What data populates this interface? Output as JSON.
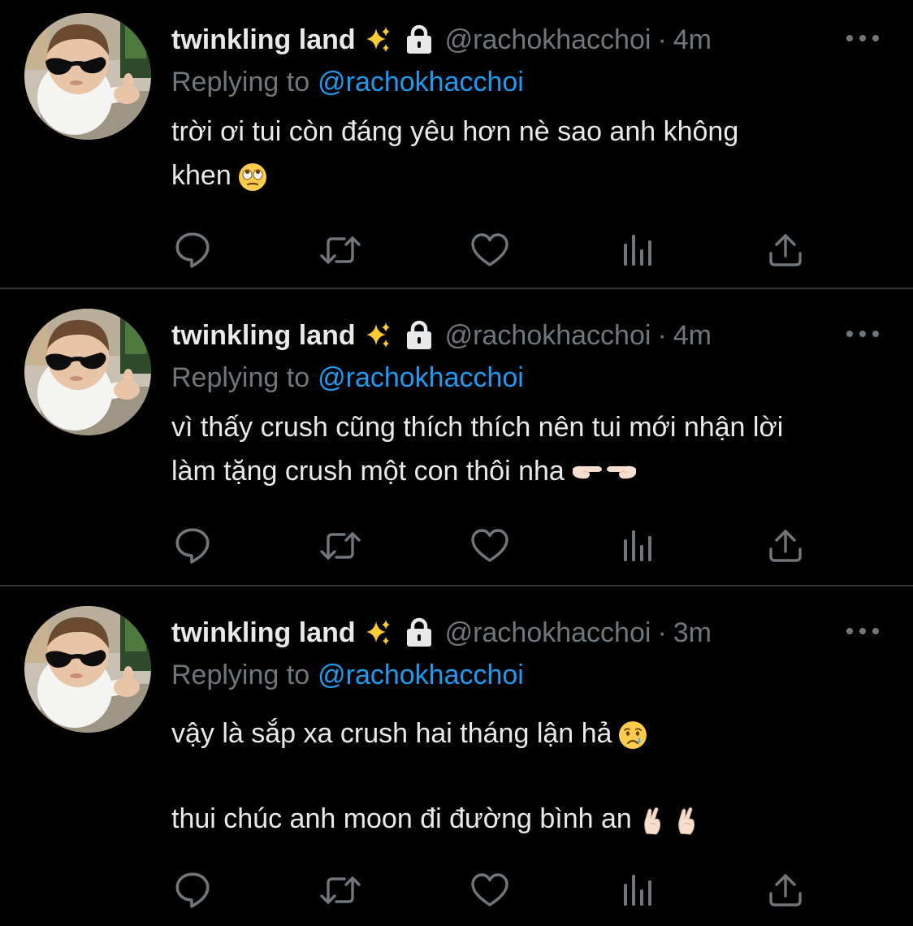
{
  "colors": {
    "background": "#000000",
    "text_primary": "#E7E9EA",
    "text_secondary": "#71767B",
    "accent": "#1D9BF0",
    "divider": "#2F3336"
  },
  "icons": {
    "more": "ellipsis-icon",
    "reply": "speech-bubble-icon",
    "retweet": "retweet-arrows-icon",
    "like": "heart-outline-icon",
    "views": "bar-chart-icon",
    "share": "upload-arrow-icon",
    "sparkle": "sparkles-emoji",
    "lock": "lock-icon"
  },
  "tweets": [
    {
      "display_name": "twinkling land",
      "handle": "@rachokhacchoi",
      "separator": "·",
      "time": "4m",
      "replying_label": "Replying to",
      "replying_to": "@rachokhacchoi",
      "lines": [
        "trời ơi tui còn đáng yêu hơn nè sao anh không",
        "khen"
      ],
      "emoji": "face-with-rolling-eyes-emoji"
    },
    {
      "display_name": "twinkling land",
      "handle": "@rachokhacchoi",
      "separator": "·",
      "time": "4m",
      "replying_label": "Replying to",
      "replying_to": "@rachokhacchoi",
      "lines": [
        "vì thấy crush cũng thích thích nên tui mới nhận lời",
        "làm tặng crush một con thôi nha"
      ],
      "emoji": "pointing-fingers-emoji"
    },
    {
      "display_name": "twinkling land",
      "handle": "@rachokhacchoi",
      "separator": "·",
      "time": "3m",
      "replying_label": "Replying to",
      "replying_to": "@rachokhacchoi",
      "lines": [
        "vậy là sắp xa crush hai tháng lận hả",
        "thui chúc anh moon đi đường bình an"
      ],
      "emoji": "crying-face-emoji",
      "emoji_2": "crossed-fingers-emoji"
    }
  ]
}
